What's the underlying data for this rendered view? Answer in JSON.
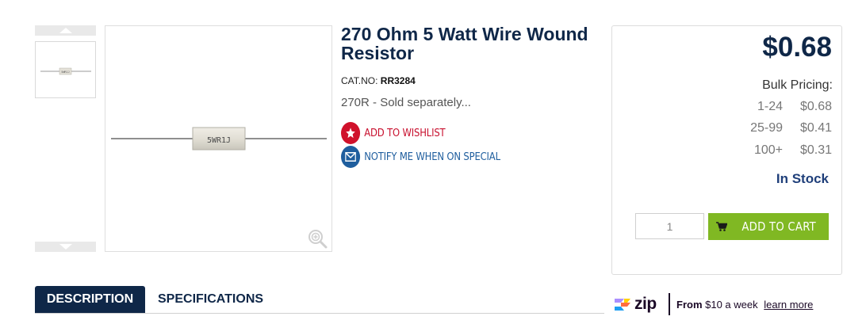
{
  "product": {
    "title": "270 Ohm 5 Watt Wire Wound Resistor",
    "catno_label": "CAT.NO:",
    "catno_value": "RR3284",
    "short_description": "270R - Sold separately...",
    "image_label": "5WR1J",
    "thumb_label": "5WR1J"
  },
  "actions": {
    "wishlist": "ADD TO WISHLIST",
    "notify": "NOTIFY ME WHEN ON SPECIAL"
  },
  "pricing": {
    "price": "$0.68",
    "bulk_label": "Bulk Pricing:",
    "tiers": [
      {
        "qty": "1-24",
        "price": "$0.68"
      },
      {
        "qty": "25-99",
        "price": "$0.41"
      },
      {
        "qty": "100+",
        "price": "$0.31"
      }
    ],
    "stock": "In Stock",
    "quantity": "1",
    "add_to_cart": "ADD TO CART"
  },
  "tabs": {
    "description": "DESCRIPTION",
    "specifications": "SPECIFICATIONS"
  },
  "zip": {
    "brand": "zip",
    "from_label": "From",
    "amount": "$10 a week",
    "link": "learn more"
  },
  "colors": {
    "navy": "#0f2748",
    "green": "#80b823",
    "wishlist_red": "#d0112b",
    "notify_blue": "#1f5e9e"
  }
}
